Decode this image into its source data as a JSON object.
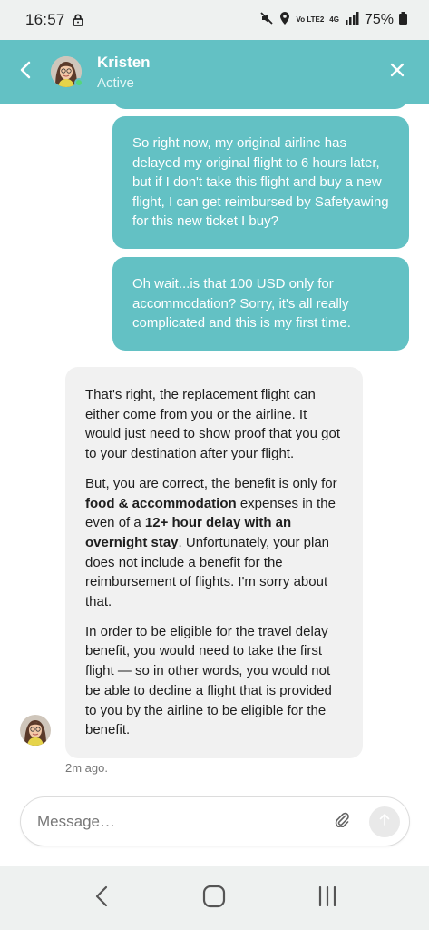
{
  "status_bar": {
    "time": "16:57",
    "network_top": "4G",
    "volte_label": "Vo LTE2",
    "battery": "75%"
  },
  "header": {
    "name": "Kristen",
    "status": "Active",
    "accent_color": "#63c1c4"
  },
  "messages": {
    "outgoing": [
      "So right now, my original airline has delayed my original flight to 6 hours later, but if I don't take this flight and buy a new flight, I can get reimbursed by Safetyawing for this new ticket I buy?",
      "Oh wait...is that 100 USD only for accommodation? Sorry, it's all really complicated and this is my first time."
    ],
    "incoming": {
      "p1": "That's right, the replacement flight can either come from you or the airline. It would just need to show proof that you got to your destination after your flight.",
      "p2_a": "But, you are correct, the benefit is only for ",
      "p2_b": "food & accommodation",
      "p2_c": " expenses in the even of a ",
      "p2_d": "12+ hour delay with an overnight stay",
      "p2_e": ". Unfortunately, your plan does not include a benefit for the reimbursement of flights. I'm sorry about that.",
      "p3": "In order to be eligible for the travel delay benefit, you would need to take the first flight — so in other words, you would not be able to decline a flight that is provided to you by the airline to be eligible for the benefit."
    },
    "timestamp": "2m ago."
  },
  "composer": {
    "placeholder": "Message…"
  },
  "icons": {
    "back": "chevron-left-icon",
    "close": "close-icon",
    "attach": "paperclip-icon",
    "send": "send-arrow-icon",
    "nav_back": "nav-back-icon",
    "nav_home": "nav-home-icon",
    "nav_recents": "nav-recents-icon"
  }
}
